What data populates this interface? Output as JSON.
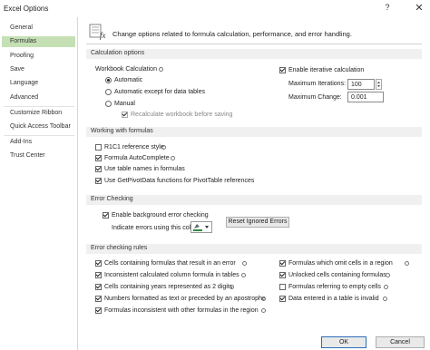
{
  "window": {
    "title": "Excel Options",
    "help_glyph": "?",
    "close_glyph": "✕"
  },
  "sidebar": {
    "items": [
      {
        "label": "General"
      },
      {
        "label": "Formulas"
      },
      {
        "label": "Proofing"
      },
      {
        "label": "Save"
      },
      {
        "label": "Language"
      },
      {
        "label": "Advanced"
      },
      {
        "label": "Customize Ribbon"
      },
      {
        "label": "Quick Access Toolbar"
      },
      {
        "label": "Add-Ins"
      },
      {
        "label": "Trust Center"
      }
    ],
    "active": "Formulas"
  },
  "header": {
    "description": "Change options related to formula calculation, performance, and error handling.",
    "icon": "formula-icon"
  },
  "calc": {
    "section_title": "Calculation options",
    "workbook_label": "Workbook Calculation",
    "automatic": "Automatic",
    "auto_except": "Automatic except for data tables",
    "manual": "Manual",
    "recalc_before_save": "Recalculate workbook before saving",
    "iterative": "Enable iterative calculation",
    "max_iter_label": "Maximum Iterations:",
    "max_iter_value": "100",
    "max_change_label": "Maximum Change:",
    "max_change_value": "0.001"
  },
  "working": {
    "section_title": "Working with formulas",
    "r1c1": "R1C1 reference style",
    "autocomplete": "Formula AutoComplete",
    "table_names": "Use table names in formulas",
    "getpivot": "Use GetPivotData functions for PivotTable references"
  },
  "error_checking": {
    "section_title": "Error Checking",
    "background": "Enable background error checking",
    "indicate_color": "Indicate errors using this color:",
    "reset_button": "Reset Ignored Errors",
    "color": "#2e8b3a"
  },
  "rules": {
    "section_title": "Error checking rules",
    "left": [
      "Cells containing formulas that result in an error",
      "Inconsistent calculated column formula in tables",
      "Cells containing years represented as 2 digits",
      "Numbers formatted as text or preceded by an apostrophe",
      "Formulas inconsistent with other formulas in the region"
    ],
    "right": [
      "Formulas which omit cells in a region",
      "Unlocked cells containing formulas",
      "Formulas referring to empty cells",
      "Data entered in a table is invalid"
    ]
  },
  "footer": {
    "ok": "OK",
    "cancel": "Cancel"
  }
}
